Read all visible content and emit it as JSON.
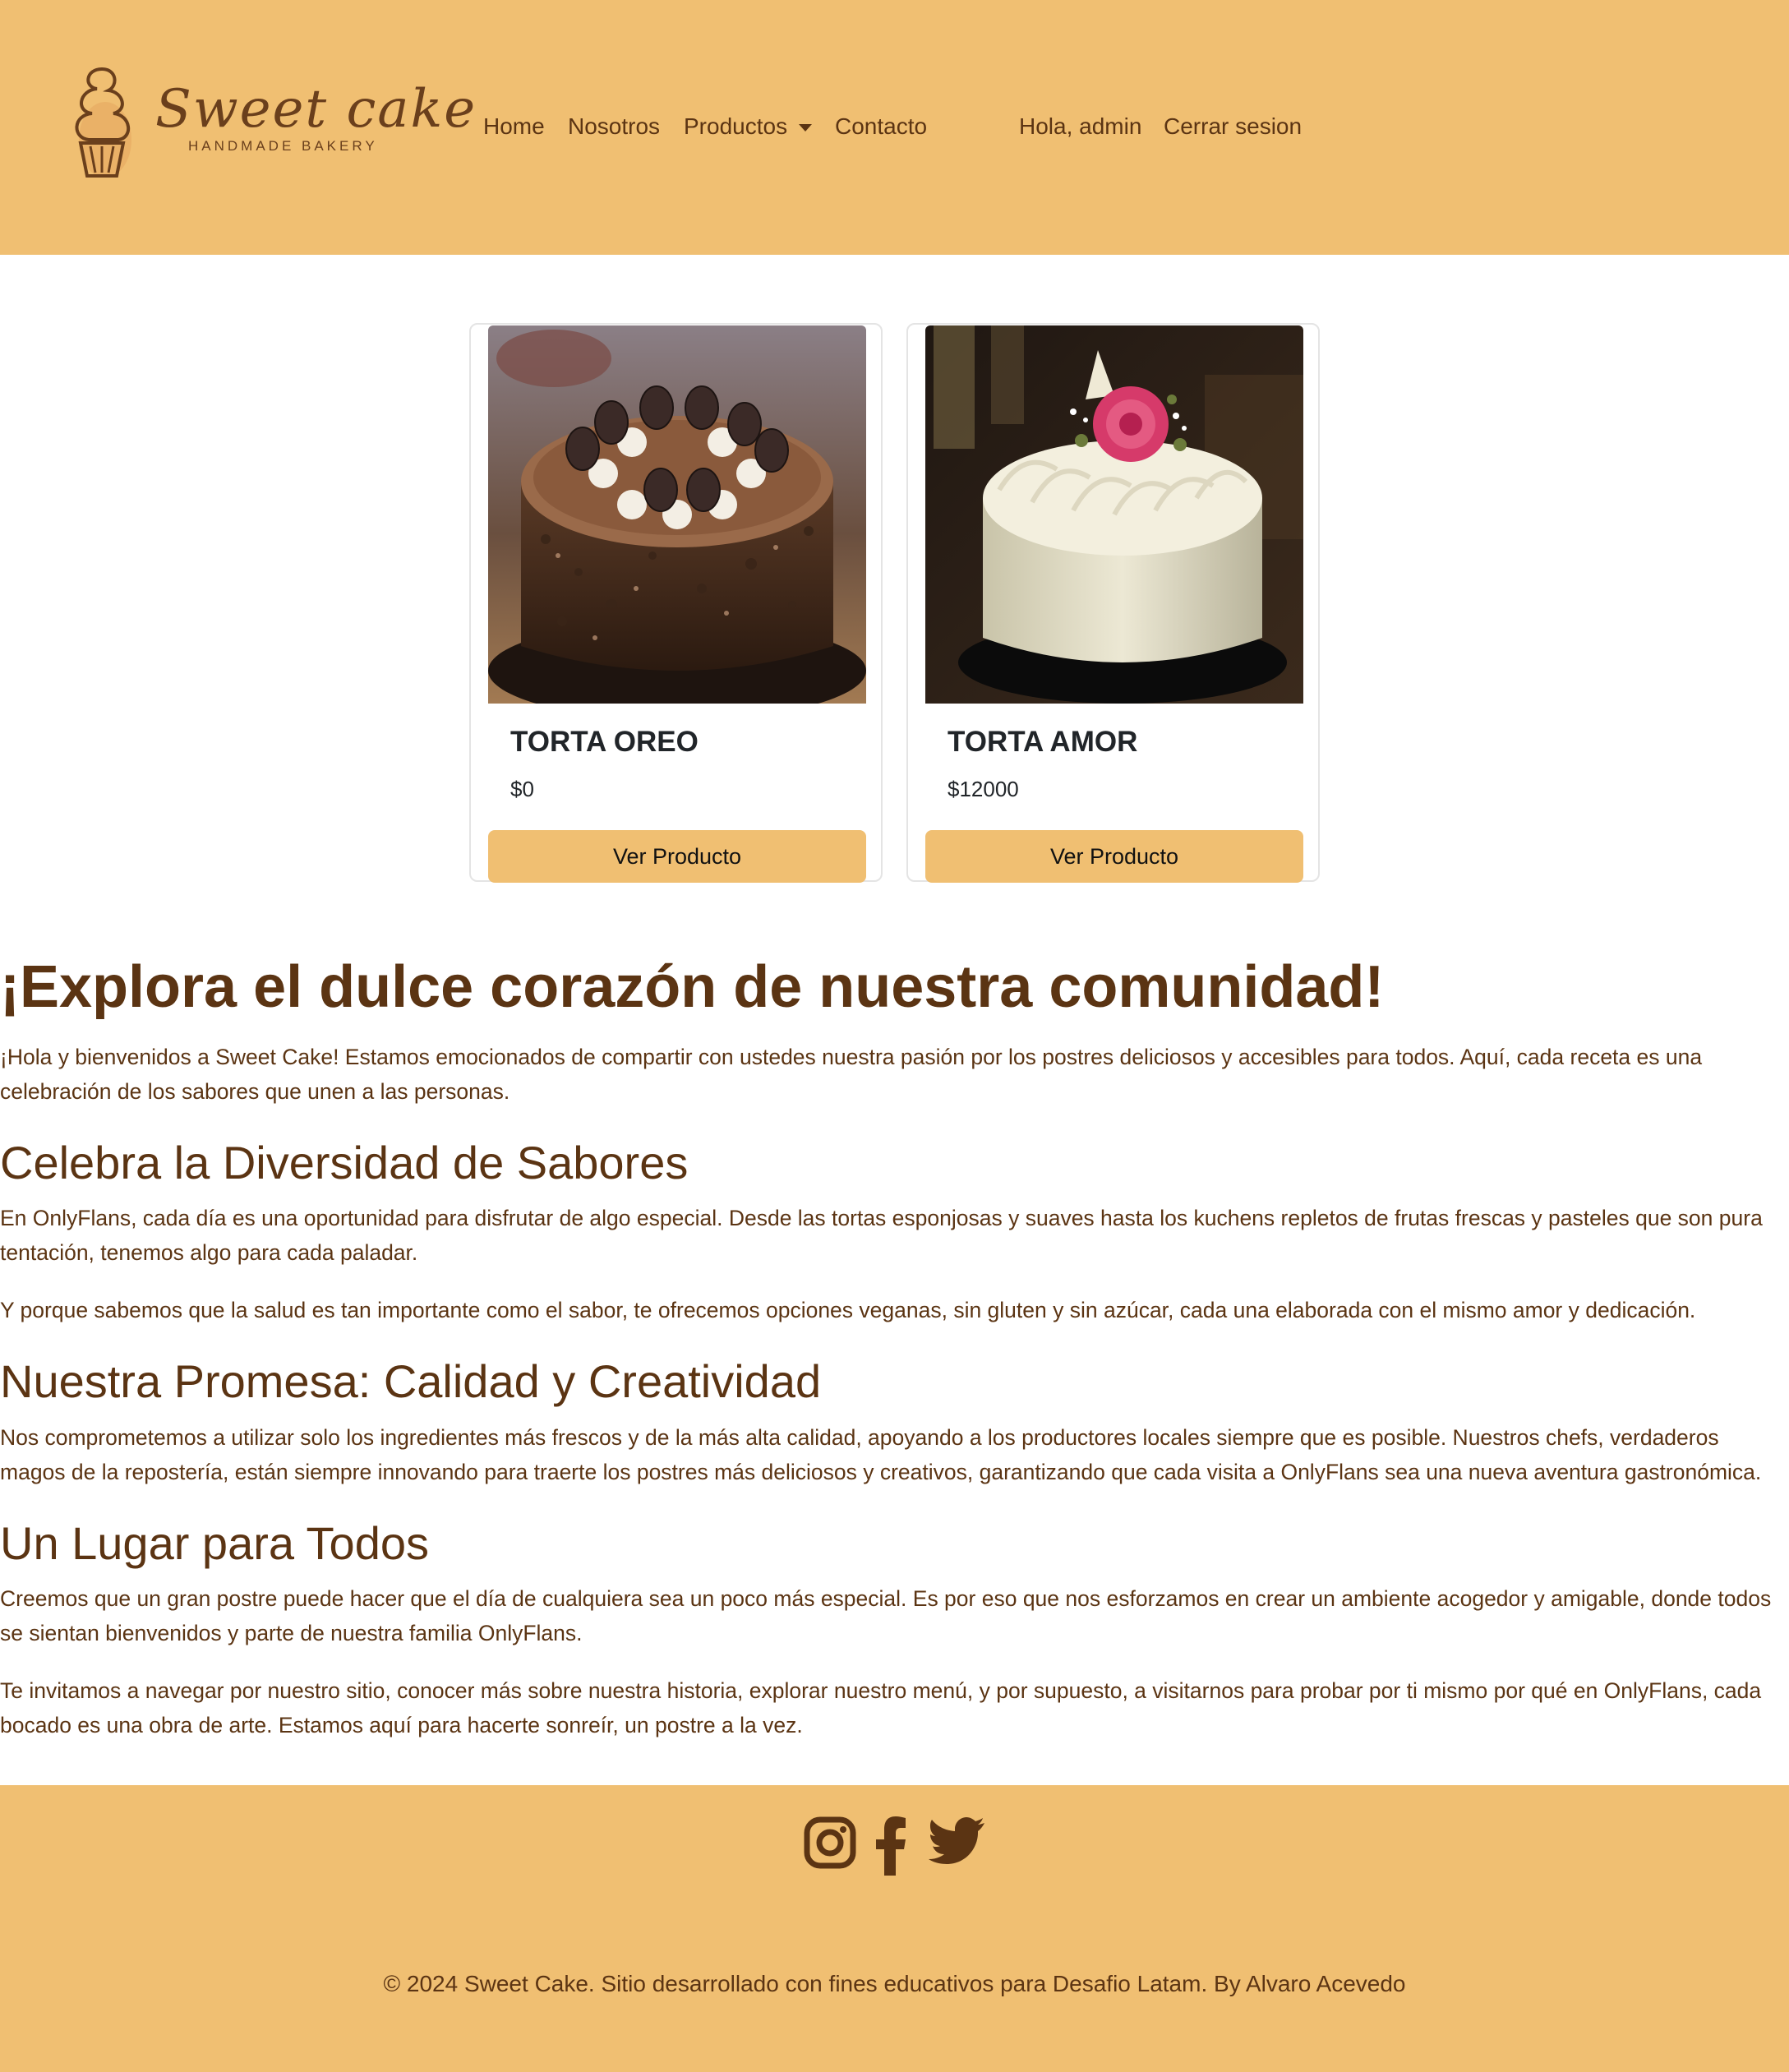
{
  "brand": {
    "name": "Sweet cake",
    "tagline": "HANDMADE BAKERY"
  },
  "nav": {
    "home": "Home",
    "about": "Nosotros",
    "products": "Productos",
    "contact": "Contacto",
    "greeting": "Hola, admin",
    "logout": "Cerrar sesion"
  },
  "products": [
    {
      "name": "TORTA OREO",
      "price": "$0",
      "button": "Ver Producto"
    },
    {
      "name": "TORTA AMOR",
      "price": "$12000",
      "button": "Ver Producto"
    }
  ],
  "content": {
    "h1": "¡Explora el dulce corazón de nuestra comunidad!",
    "p1": "¡Hola y bienvenidos a Sweet Cake! Estamos emocionados de compartir con ustedes nuestra pasión por los postres deliciosos y accesibles para todos. Aquí, cada receta es una celebración de los sabores que unen a las personas.",
    "h2a": "Celebra la Diversidad de Sabores",
    "p2": "En OnlyFlans, cada día es una oportunidad para disfrutar de algo especial. Desde las tortas esponjosas y suaves hasta los kuchens repletos de frutas frescas y pasteles que son pura tentación, tenemos algo para cada paladar.",
    "p3": "Y porque sabemos que la salud es tan importante como el sabor, te ofrecemos opciones veganas, sin gluten y sin azúcar, cada una elaborada con el mismo amor y dedicación.",
    "h2b": "Nuestra Promesa: Calidad y Creatividad",
    "p4": "Nos comprometemos a utilizar solo los ingredientes más frescos y de la más alta calidad, apoyando a los productores locales siempre que es posible. Nuestros chefs, verdaderos magos de la repostería, están siempre innovando para traerte los postres más deliciosos y creativos, garantizando que cada visita a OnlyFlans sea una nueva aventura gastronómica.",
    "h2c": "Un Lugar para Todos",
    "p5": "Creemos que un gran postre puede hacer que el día de cualquiera sea un poco más especial. Es por eso que nos esforzamos en crear un ambiente acogedor y amigable, donde todos se sientan bienvenidos y parte de nuestra familia OnlyFlans.",
    "p6": "Te invitamos a navegar por nuestro sitio, conocer más sobre nuestra historia, explorar nuestro menú, y por supuesto, a visitarnos para probar por ti mismo por qué en OnlyFlans, cada bocado es una obra de arte. Estamos aquí para hacerte sonreír, un postre a la vez."
  },
  "footer": {
    "social": [
      "instagram-icon",
      "facebook-icon",
      "twitter-icon"
    ],
    "copyright": "© 2024 Sweet Cake. Sitio desarrollado con fines educativos para Desafio Latam. By Alvaro Acevedo"
  },
  "colors": {
    "primary": "#f0bf72",
    "text_brown": "#5b3413"
  }
}
